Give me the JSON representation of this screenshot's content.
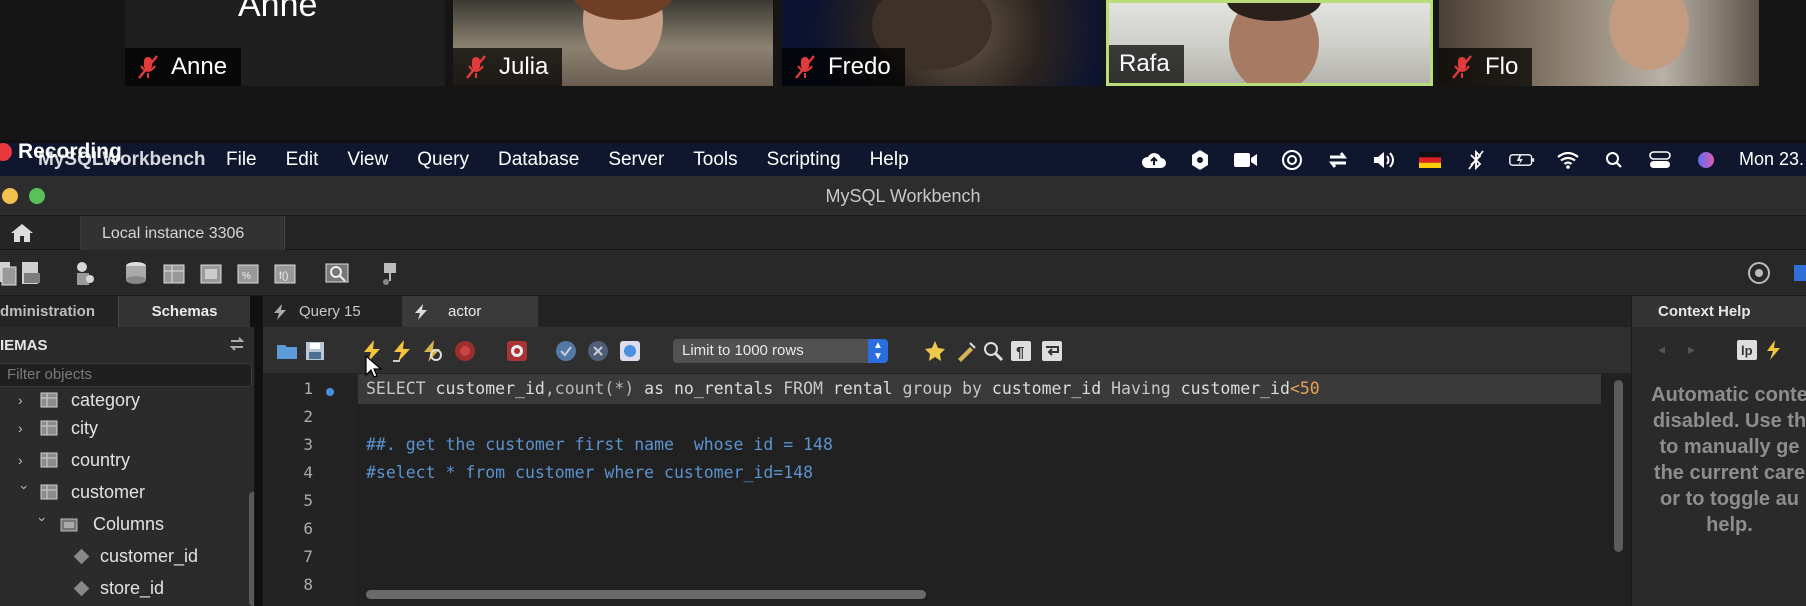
{
  "video": {
    "anne_heading": "Anne",
    "participants": [
      "Anne",
      "Julia",
      "Fredo",
      "Rafa",
      "Flo"
    ]
  },
  "recording_label": "Recording",
  "menubar": {
    "app": "MySQLWorkbench",
    "items": [
      "File",
      "Edit",
      "View",
      "Query",
      "Database",
      "Server",
      "Tools",
      "Scripting",
      "Help"
    ],
    "clock": "Mon 23."
  },
  "window": {
    "title": "MySQL Workbench"
  },
  "connection_tab": "Local instance 3306",
  "sidebar": {
    "tabs": {
      "administration": "dministration",
      "schemas": "Schemas"
    },
    "header": "IEMAS",
    "filter_placeholder": "Filter objects",
    "tree": [
      {
        "label": "category",
        "kind": "table",
        "expanded": false
      },
      {
        "label": "city",
        "kind": "table",
        "expanded": false
      },
      {
        "label": "country",
        "kind": "table",
        "expanded": false
      },
      {
        "label": "customer",
        "kind": "table",
        "expanded": true
      },
      {
        "label": "Columns",
        "kind": "folder",
        "expanded": true
      },
      {
        "label": "customer_id",
        "kind": "column"
      },
      {
        "label": "store_id",
        "kind": "column"
      }
    ]
  },
  "query_tabs": [
    "Query 15",
    "actor"
  ],
  "editor": {
    "limit_select": "Limit to 1000 rows",
    "line_numbers": [
      "1",
      "2",
      "3",
      "4",
      "5",
      "6",
      "7",
      "8"
    ],
    "lines": {
      "l1": {
        "kw1": "SELECT",
        "t1": " customer_id",
        "fn": ",count(*)",
        "t2": " as no_rentals ",
        "kw2": "FROM",
        "t3": " rental ",
        "kw3": "group by",
        "t4": " customer_id ",
        "kw4": "Having",
        "t5": " customer_id",
        "op": "<",
        "num": "50"
      },
      "l3": "##. get the customer first name  whose id = 148",
      "l4": "#select * from customer where customer_id=148"
    }
  },
  "context_help": {
    "title": "Context Help",
    "text": [
      "Automatic conte",
      "disabled. Use th",
      "to manually ge",
      "the current care",
      "or to toggle au",
      "help."
    ]
  }
}
